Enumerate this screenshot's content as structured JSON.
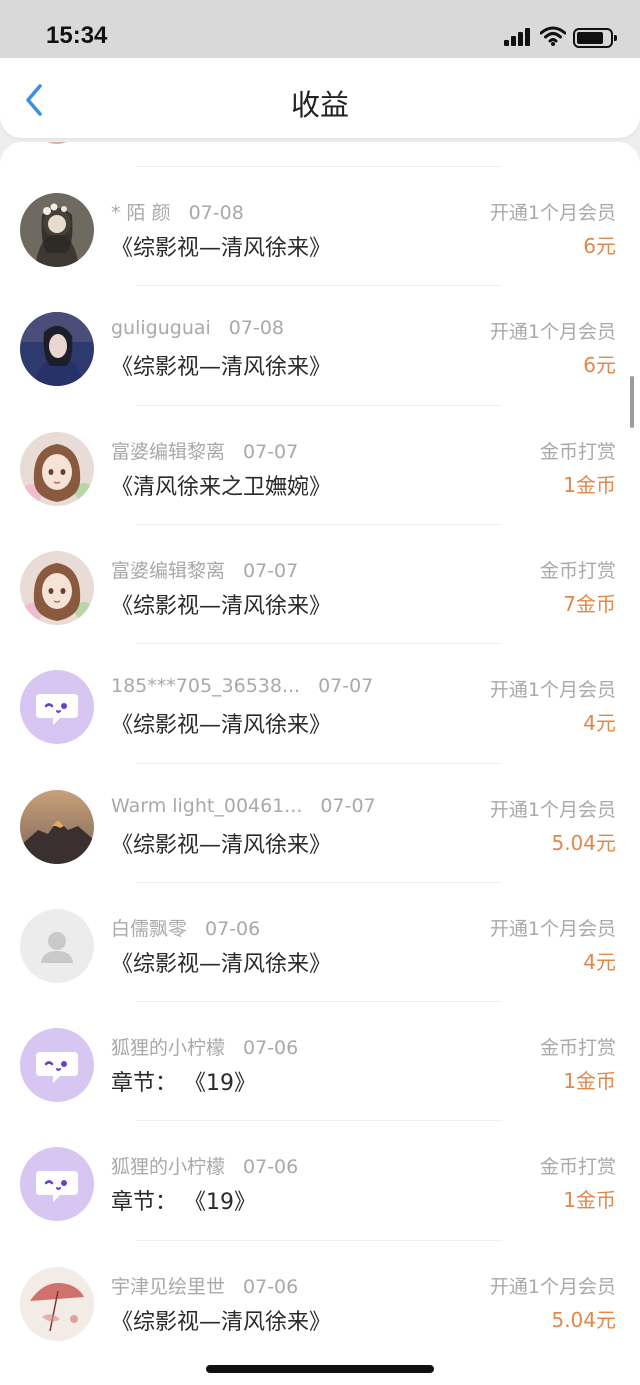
{
  "status_bar": {
    "time": "15:34"
  },
  "header": {
    "title": "收益"
  },
  "colors": {
    "amount": "#e0884a",
    "back": "#3a8ee6",
    "bubble_bg": "#d7c6f2",
    "bubble_fg": "#6a3fd0"
  },
  "items": [
    {
      "name": "* 陌 颜",
      "date": "07-08",
      "title": "《综影视—清风徐来》",
      "type": "开通1个月会员",
      "amount": "6元",
      "avatar": "photo-girl-flowers"
    },
    {
      "name": "guliguguai",
      "date": "07-08",
      "title": "《综影视—清风徐来》",
      "type": "开通1个月会员",
      "amount": "6元",
      "avatar": "photo-girl-blue"
    },
    {
      "name": "富婆编辑黎离",
      "date": "07-07",
      "title": "《清风徐来之卫嫵婉》",
      "type": "金币打赏",
      "amount": "1金币",
      "avatar": "anime-girl"
    },
    {
      "name": "富婆编辑黎离",
      "date": "07-07",
      "title": "《综影视—清风徐来》",
      "type": "金币打赏",
      "amount": "7金币",
      "avatar": "anime-girl"
    },
    {
      "name": "185***705_36538...",
      "date": "07-07",
      "title": "《综影视—清风徐来》",
      "type": "开通1个月会员",
      "amount": "4元",
      "avatar": "chat-bubble"
    },
    {
      "name": "Warm light_00461...",
      "date": "07-07",
      "title": "《综影视—清风徐来》",
      "type": "开通1个月会员",
      "amount": "5.04元",
      "avatar": "mountain"
    },
    {
      "name": "白儒飘零",
      "date": "07-06",
      "title": "《综影视—清风徐来》",
      "type": "开通1个月会员",
      "amount": "4元",
      "avatar": "default-user"
    },
    {
      "name": "狐狸的小柠檬",
      "date": "07-06",
      "title": "章节： 《19》",
      "type": "金币打赏",
      "amount": "1金币",
      "avatar": "chat-bubble"
    },
    {
      "name": "狐狸的小柠檬",
      "date": "07-06",
      "title": "章节： 《19》",
      "type": "金币打赏",
      "amount": "1金币",
      "avatar": "chat-bubble"
    },
    {
      "name": "宇津见绘里世",
      "date": "07-06",
      "title": "《综影视—清风徐来》",
      "type": "开通1个月会员",
      "amount": "5.04元",
      "avatar": "red-umbrella"
    }
  ]
}
